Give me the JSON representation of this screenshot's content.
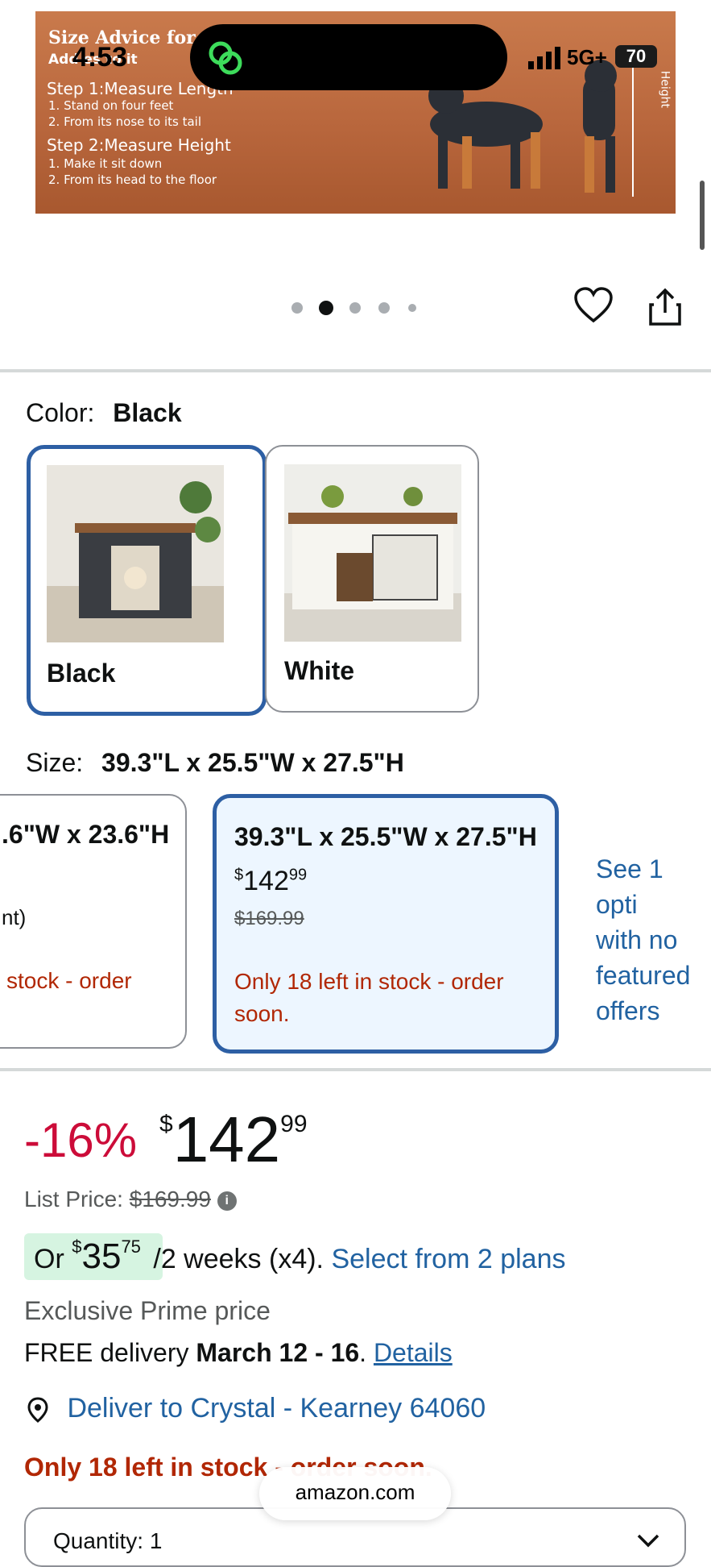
{
  "status_bar": {
    "time": "4:53",
    "network": "5G+",
    "battery": "70"
  },
  "banner": {
    "title": "Size Advice for",
    "subtitle": "Add es to it",
    "step1_title": "Step 1:Measure Length",
    "step1_a": "1. Stand on four feet",
    "step1_b": "2. From its nose to its tail",
    "step2_title": "Step 2:Measure Height",
    "step2_a": "1. Make it sit down",
    "step2_b": "2. From its head to the floor",
    "height_label": "Height"
  },
  "gallery": {
    "dot_count": 5,
    "active_dot": 1
  },
  "color": {
    "label": "Color:",
    "selected": "Black",
    "options": [
      {
        "name": "Black"
      },
      {
        "name": "White"
      }
    ]
  },
  "size": {
    "label": "Size:",
    "selected": "39.3\"L x 25.5\"W x 27.5\"H",
    "options": [
      {
        "dims": ".6\"W x 23.6\"H",
        "note": "nt)",
        "stock": "stock - order"
      },
      {
        "dims": "39.3\"L x 25.5\"W x 27.5\"H",
        "price_whole": "142",
        "price_fraction": "99",
        "currency": "$",
        "list_price": "$169.99",
        "stock_line1": "Only 18 left in stock - order",
        "stock_line2": "soon."
      }
    ],
    "see_more": [
      "See 1 opti",
      "with no",
      "featured",
      "offers"
    ]
  },
  "price": {
    "discount": "-16%",
    "currency": "$",
    "whole": "142",
    "fraction": "99",
    "list_label": "List Price:",
    "list_value": "$169.99",
    "installment_prefix": "Or",
    "installment_currency": "$",
    "installment_whole": "35",
    "installment_fraction": "75",
    "installment_suffix": "/2 weeks (x4).",
    "installment_link": "Select from 2 plans",
    "prime_text": "Exclusive Prime price",
    "delivery_prefix": "FREE delivery",
    "delivery_dates": "March 12 - 16",
    "delivery_sep": ".",
    "details_link": "Details",
    "deliver_to": "Deliver to Crystal - Kearney 64060",
    "stock_warning": "Only 18 left in stock - order soon."
  },
  "quantity": {
    "label": "Quantity: 1"
  },
  "browser": {
    "url": "amazon.com"
  }
}
